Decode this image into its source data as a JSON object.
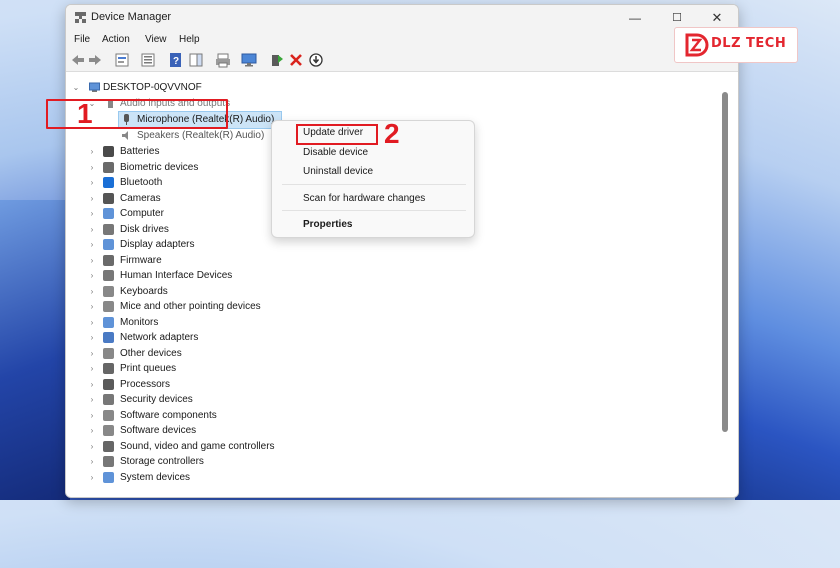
{
  "window": {
    "title": "Device Manager",
    "minimize_glyph": "—",
    "maximize_glyph": "☐",
    "close_glyph": "✕"
  },
  "menu": {
    "items": [
      "File",
      "Action",
      "View",
      "Help"
    ]
  },
  "toolbar": {
    "icons": [
      "back-icon",
      "forward-icon",
      "properties-icon",
      "show-hidden-icon",
      "help-icon",
      "action-pane-icon",
      "print-icon",
      "monitor-icon",
      "update-driver-icon",
      "uninstall-icon",
      "scan-icon"
    ]
  },
  "tree": {
    "root": "DESKTOP-0QVVNOF",
    "expanded": {
      "label": "Audio inputs and outputs",
      "children": [
        "Microphone (Realtek(R) Audio)",
        "Speakers (Realtek(R) Audio)"
      ]
    },
    "categories": [
      "Batteries",
      "Biometric devices",
      "Bluetooth",
      "Cameras",
      "Computer",
      "Disk drives",
      "Display adapters",
      "Firmware",
      "Human Interface Devices",
      "Keyboards",
      "Mice and other pointing devices",
      "Monitors",
      "Network adapters",
      "Other devices",
      "Print queues",
      "Processors",
      "Security devices",
      "Software components",
      "Software devices",
      "Sound, video and game controllers",
      "Storage controllers",
      "System devices"
    ]
  },
  "context_menu": {
    "items": [
      "Update driver",
      "Disable device",
      "Uninstall device",
      "Scan for hardware changes",
      "Properties"
    ]
  },
  "annotations": {
    "step1": "1",
    "step2": "2"
  },
  "logo": {
    "text": "DLZ TECH"
  },
  "colors": {
    "accent_red": "#e11b22",
    "selection": "#cce4f7"
  }
}
